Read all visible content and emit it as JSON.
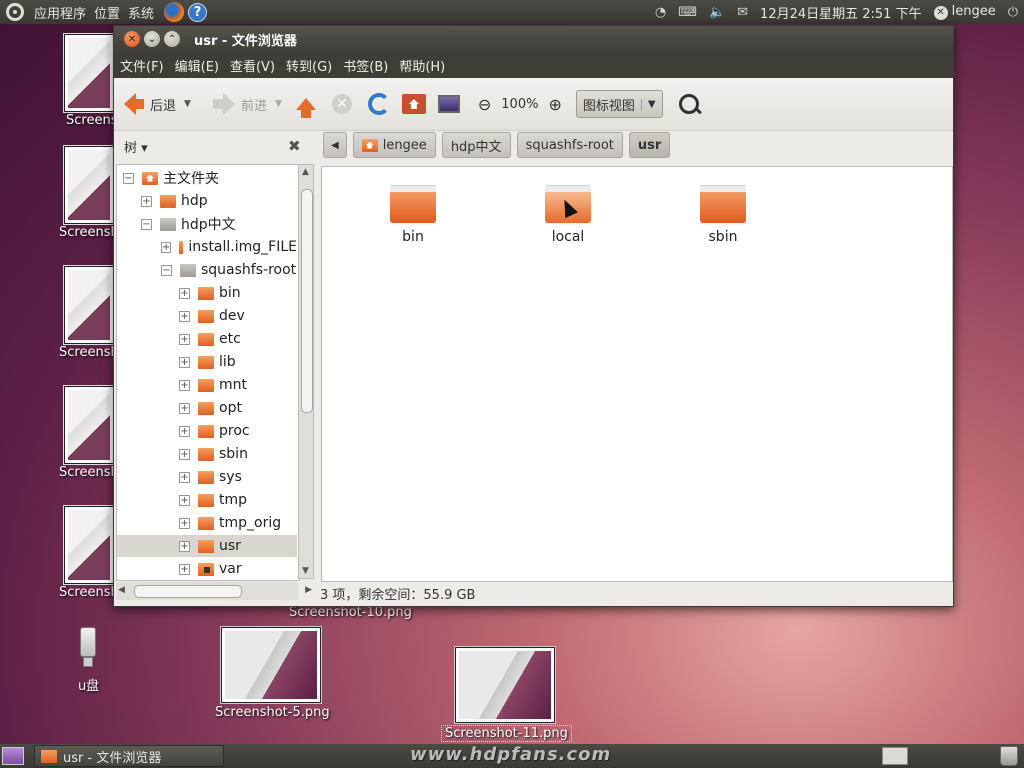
{
  "top_panel": {
    "menus": [
      "应用程序",
      "位置",
      "系统"
    ],
    "datetime": "12月24日星期五  2:51 下午",
    "user": "lengee"
  },
  "desktop": {
    "side_labels": [
      "Screens",
      "Screensh",
      "Screensh",
      "Screensh",
      "Screensh"
    ],
    "file_labels": [
      "Screenshot-10.png",
      "Screenshot-5.png",
      "Screenshot-11.png"
    ],
    "usb_label": "u盘"
  },
  "window": {
    "title": "usr - 文件浏览器",
    "menubar": [
      "文件(F)",
      "编辑(E)",
      "查看(V)",
      "转到(G)",
      "书签(B)",
      "帮助(H)"
    ],
    "toolbar": {
      "back": "后退",
      "forward": "前进",
      "zoom": "100%",
      "view_mode": "图标视图"
    },
    "side_pane": {
      "header": "树",
      "rows": [
        {
          "label": "主文件夹",
          "exp": "−"
        },
        {
          "label": "hdp",
          "exp": "+"
        },
        {
          "label": "hdp中文",
          "exp": "−"
        },
        {
          "label": "install.img_FILE",
          "exp": "+"
        },
        {
          "label": "squashfs-root",
          "exp": "−"
        },
        {
          "label": "bin",
          "exp": "+"
        },
        {
          "label": "dev",
          "exp": "+"
        },
        {
          "label": "etc",
          "exp": "+"
        },
        {
          "label": "lib",
          "exp": "+"
        },
        {
          "label": "mnt",
          "exp": "+"
        },
        {
          "label": "opt",
          "exp": "+"
        },
        {
          "label": "proc",
          "exp": "+"
        },
        {
          "label": "sbin",
          "exp": "+"
        },
        {
          "label": "sys",
          "exp": "+"
        },
        {
          "label": "tmp",
          "exp": "+"
        },
        {
          "label": "tmp_orig",
          "exp": "+"
        },
        {
          "label": "usr",
          "exp": "+"
        },
        {
          "label": "var",
          "exp": "+"
        }
      ]
    },
    "breadcrumbs": [
      "lengee",
      "hdp中文",
      "squashfs-root",
      "usr"
    ],
    "items": [
      "bin",
      "local",
      "sbin"
    ],
    "status": "3 项，剩余空间：55.9 GB"
  },
  "bottom_panel": {
    "task_label": "usr - 文件浏览器",
    "watermark": "www.hdpfans.com"
  }
}
